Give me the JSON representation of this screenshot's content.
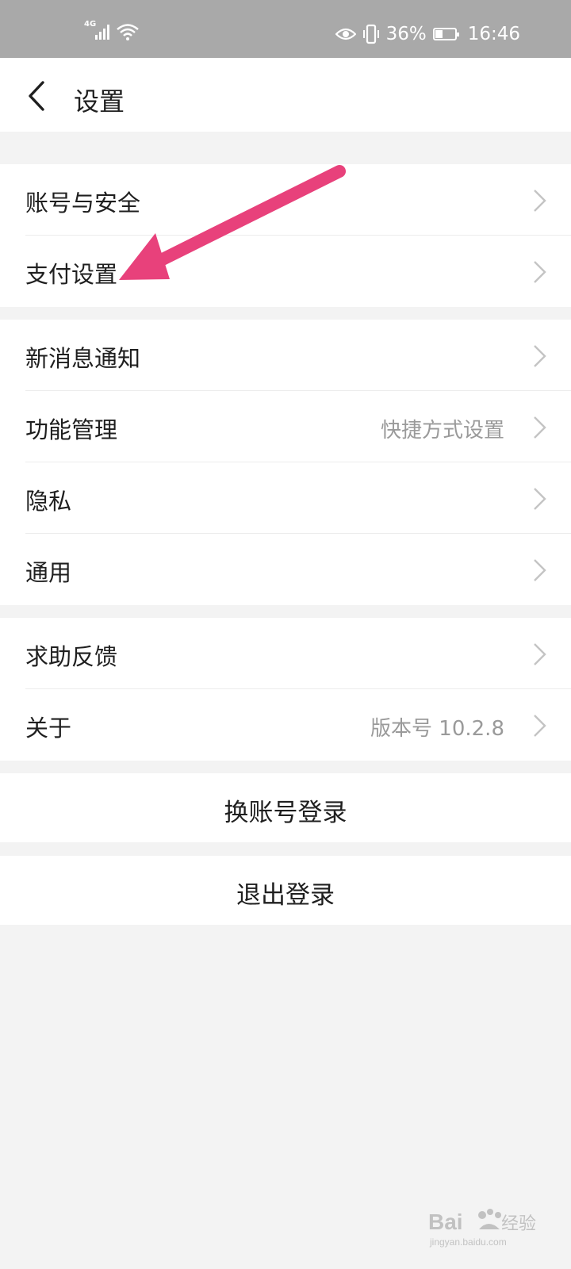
{
  "status_bar": {
    "network": "4G",
    "battery": "36%",
    "battery_level": 0.36,
    "time": "16:46"
  },
  "header": {
    "title": "设置"
  },
  "groups": [
    {
      "items": [
        {
          "label": "账号与安全",
          "value": ""
        },
        {
          "label": "支付设置",
          "value": ""
        }
      ]
    },
    {
      "items": [
        {
          "label": "新消息通知",
          "value": ""
        },
        {
          "label": "功能管理",
          "value": "快捷方式设置"
        },
        {
          "label": "隐私",
          "value": ""
        },
        {
          "label": "通用",
          "value": ""
        }
      ]
    },
    {
      "items": [
        {
          "label": "求助反馈",
          "value": ""
        },
        {
          "label": "关于",
          "value": "版本号 10.2.8"
        }
      ]
    }
  ],
  "actions": {
    "switch_account": "换账号登录",
    "logout": "退出登录"
  },
  "annotation": {
    "color": "#e8417b"
  },
  "watermark": {
    "brand": "Baidu经验",
    "url": "jingyan.baidu.com"
  }
}
